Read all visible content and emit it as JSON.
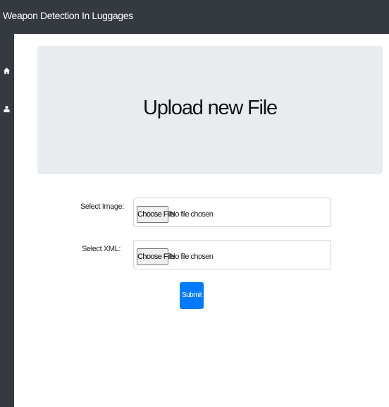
{
  "app": {
    "title": "Weapon Detection In Luggages"
  },
  "sidebar": {
    "icons": [
      "home-icon",
      "user-upload-icon"
    ]
  },
  "main": {
    "heading": "Upload new File",
    "form": {
      "image_label": "Select Image:",
      "xml_label": "Select XML:",
      "choose_file_label": "Choose File",
      "no_file_text": "No file chosen",
      "submit_label": "Submit"
    }
  },
  "colors": {
    "navbar": "#343a40",
    "jumbotron": "#e9ecef",
    "primary": "#007bff"
  }
}
